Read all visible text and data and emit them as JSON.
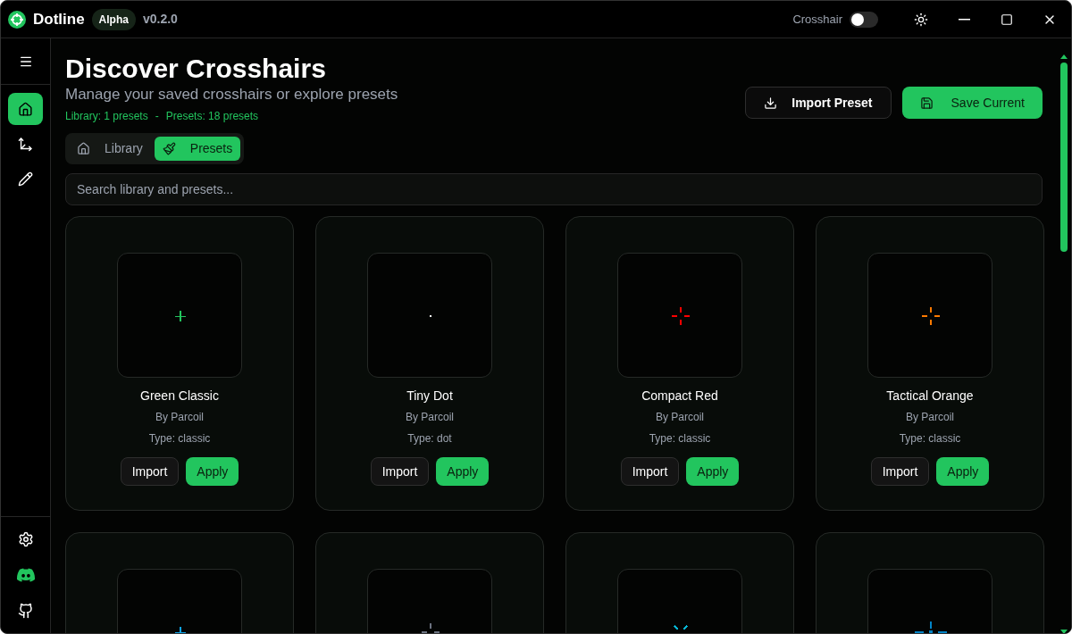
{
  "app": {
    "name": "Dotline",
    "badge": "Alpha",
    "version": "v0.2.0"
  },
  "titlebar": {
    "toggle_label": "Crosshair",
    "toggle_on": false
  },
  "sidebar": {
    "top": [
      {
        "kind": "home",
        "selected": true
      },
      {
        "kind": "axes",
        "selected": false
      },
      {
        "kind": "pencil",
        "selected": false
      }
    ],
    "bottom": [
      {
        "kind": "settings"
      },
      {
        "kind": "discord"
      },
      {
        "kind": "github"
      }
    ]
  },
  "header": {
    "title": "Discover Crosshairs",
    "subtitle": "Manage your saved crosshairs or explore presets",
    "stats_library": "Library: 1 presets",
    "stats_separator": "-",
    "stats_presets": "Presets: 18 presets",
    "import_button": "Import Preset",
    "save_button": "Save Current"
  },
  "tabs": [
    {
      "label": "Library",
      "kind": "home",
      "selected": false
    },
    {
      "label": "Presets",
      "kind": "brush",
      "selected": true
    }
  ],
  "search": {
    "placeholder": "Search library and presets..."
  },
  "cards": [
    {
      "name": "Green Classic",
      "author": "By Parcoil",
      "type": "Type: classic",
      "kind": "plus",
      "color": "#22c55e",
      "import": "Import",
      "apply": "Apply"
    },
    {
      "name": "Tiny Dot",
      "author": "By Parcoil",
      "type": "Type: dot",
      "kind": "dot",
      "color": "#ffffff",
      "import": "Import",
      "apply": "Apply"
    },
    {
      "name": "Compact Red",
      "author": "By Parcoil",
      "type": "Type: classic",
      "kind": "gap",
      "color": "#ff0000",
      "import": "Import",
      "apply": "Apply"
    },
    {
      "name": "Tactical Orange",
      "author": "By Parcoil",
      "type": "Type: classic",
      "kind": "gap",
      "color": "#ff7a00",
      "import": "Import",
      "apply": "Apply"
    },
    {
      "kind": "plus",
      "color": "#0ea5e9"
    },
    {
      "kind": "gap",
      "color": "#6b7280"
    },
    {
      "kind": "x",
      "color": "#06b6d4"
    },
    {
      "kind": "spread",
      "color": "#0284c7"
    }
  ]
}
